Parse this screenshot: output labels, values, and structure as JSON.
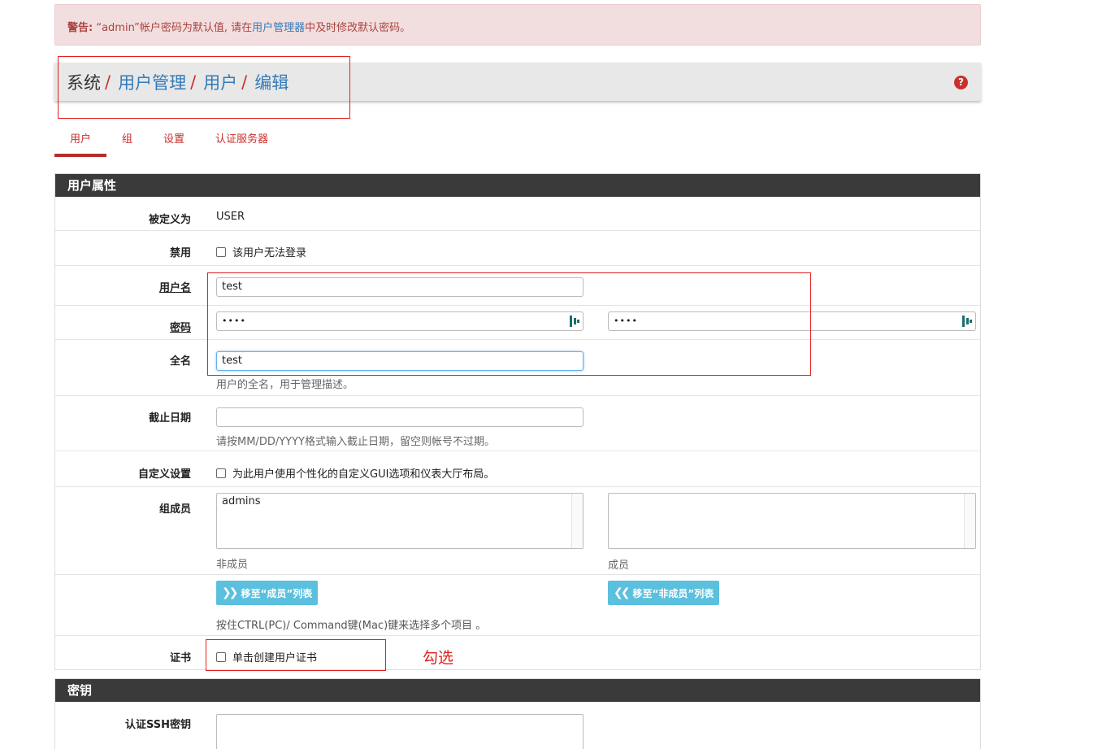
{
  "alert": {
    "prefix": "警告:",
    "text_before": " “admin”帐户密码为默认值, 请在",
    "link": "用户管理器",
    "text_after": "中及时修改默认密码。"
  },
  "breadcrumb": {
    "items": [
      "系统",
      "用户管理",
      "用户",
      "编辑"
    ],
    "separator": "/",
    "help_icon_glyph": "?"
  },
  "tabs": [
    "用户",
    "组",
    "设置",
    "认证服务器"
  ],
  "user_props": {
    "title": "用户属性",
    "defined_as_label": "被定义为",
    "defined_as_value": "USER",
    "disabled_label": "禁用",
    "disabled_text": "该用户无法登录",
    "username_label": "用户名",
    "username_value": "test",
    "password_label": "密码",
    "password_value": "••••",
    "password_confirm_value": "••••",
    "fullname_label": "全名",
    "fullname_value": "test",
    "fullname_help": "用户的全名，用于管理描述。",
    "expiry_label": "截止日期",
    "expiry_value": "",
    "expiry_help": "请按MM/DD/YYYY格式输入截止日期，留空则帐号不过期。",
    "custom_label": "自定义设置",
    "custom_text": "为此用户使用个性化的自定义GUI选项和仪表大厅布局。",
    "group_label": "组成员",
    "not_member_items": [
      "admins"
    ],
    "not_member_caption": "非成员",
    "member_items": [],
    "member_caption": "成员",
    "move_to_member_btn": "移至“成员”列表",
    "move_to_nonmember_btn": "移至“非成员”列表",
    "multi_select_help": "按住CTRL(PC)/ Command键(Mac)键来选择多个项目 。",
    "cert_label": "证书",
    "cert_text": "单击创建用户证书"
  },
  "annotation": "勾选",
  "keys": {
    "title": "密钥",
    "ssh_label": "认证SSH密钥",
    "ssh_value": ""
  },
  "colors": {
    "accent_red": "#c9302c",
    "link_blue": "#337ab7",
    "button_info": "#5bc0de",
    "panel_header": "#3a3a3a",
    "annotation_red": "#e02020"
  }
}
